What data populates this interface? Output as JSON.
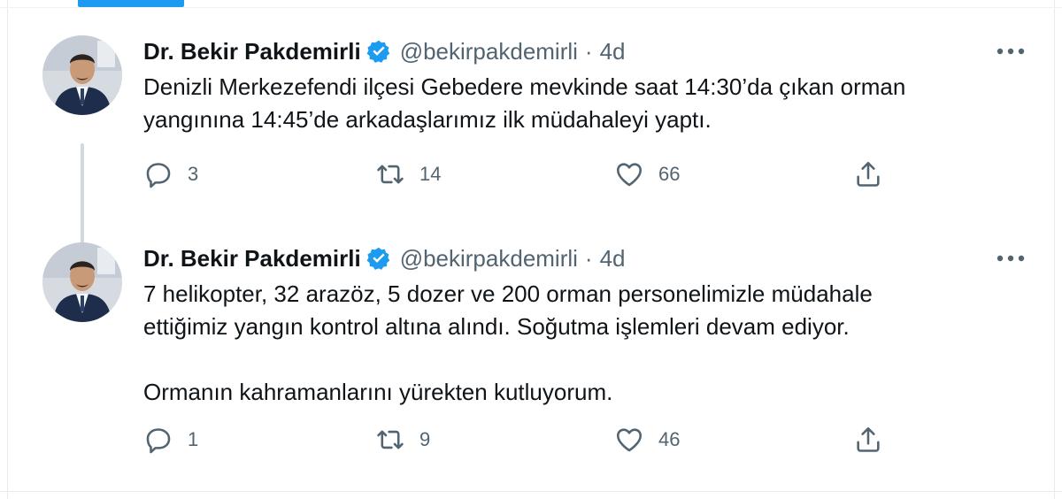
{
  "tweets": [
    {
      "author_name": "Dr. Bekir Pakdemirli",
      "handle": "@bekirpakdemirli",
      "separator": "·",
      "time": "4d",
      "text": "Denizli Merkezefendi ilçesi Gebedere mevkinde saat 14:30’da çıkan orman\nyangınına 14:45’de arkadaşlarımız ilk müdahaleyi yaptı.",
      "replies": "3",
      "retweets": "14",
      "likes": "66"
    },
    {
      "author_name": "Dr. Bekir Pakdemirli",
      "handle": "@bekirpakdemirli",
      "separator": "·",
      "time": "4d",
      "text": "7 helikopter, 32 arazöz, 5 dozer ve 200 orman personelimizle müdahale\nettiğimiz yangın kontrol altına alındı. Soğutma işlemleri devam ediyor.\n\nOrmanın kahramanlarını yürekten kutluyorum.",
      "replies": "1",
      "retweets": "9",
      "likes": "46"
    }
  ],
  "icons": {
    "verified": "verified-badge-icon",
    "more": "more-dots-icon",
    "reply": "reply-bubble-icon",
    "retweet": "retweet-arrows-icon",
    "like": "heart-icon",
    "share": "share-upload-icon"
  },
  "colors": {
    "accent": "#1d9bf0",
    "text": "#0f1419",
    "muted": "#536471",
    "thread_line": "#cfd9de"
  }
}
